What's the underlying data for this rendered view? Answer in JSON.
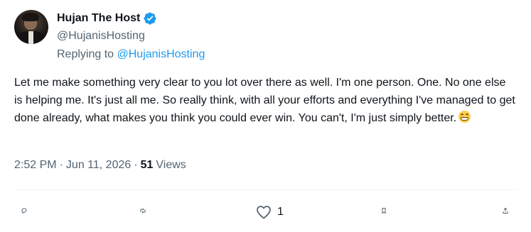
{
  "tweet": {
    "display_name": "Hujan The Host",
    "handle": "@HujanisHosting",
    "reply_prefix": "Replying to",
    "reply_to": "@HujanisHosting",
    "text": "Let me make something very clear to you lot over there as well. I'm one person. One. No one else is helping me. It's just all me. So really think, with all your efforts and everything I've managed to get done already, what makes you think you could ever win. You can't, I'm just simply better.",
    "emoji": "grimacing-face",
    "time": "2:52 PM",
    "date": "Jun 11, 2026",
    "separator": "·",
    "views_count": "51",
    "views_label": "Views",
    "verified": true
  },
  "actions": {
    "reply_icon": "reply-icon",
    "retweet_icon": "retweet-icon",
    "like_icon": "heart-icon",
    "like_count": "1",
    "bookmark_icon": "bookmark-icon",
    "share_icon": "share-icon"
  },
  "colors": {
    "verified": "#1d9bf0",
    "link": "#1d9bf0",
    "secondary_text": "#536471",
    "primary_text": "#0f1419"
  }
}
